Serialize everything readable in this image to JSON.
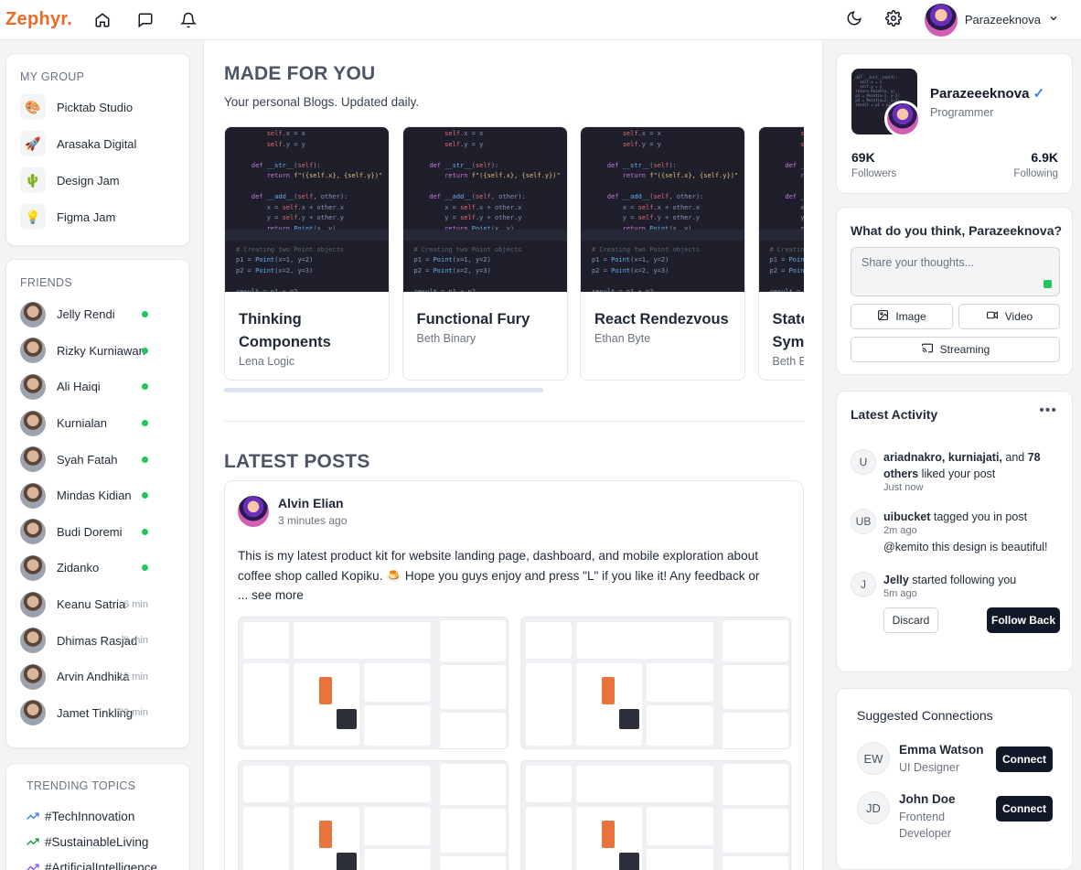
{
  "brand": {
    "name": "Zephyr."
  },
  "topbar": {
    "username": "Parazeeknova"
  },
  "my_group": {
    "title": "MY GROUP",
    "items": [
      {
        "label": "Picktab Studio",
        "icon": "palette-icon",
        "glyph": "🎨"
      },
      {
        "label": "Arasaka Digital",
        "icon": "rocket-icon",
        "glyph": "🚀"
      },
      {
        "label": "Design Jam",
        "icon": "cactus-icon",
        "glyph": "🌵"
      },
      {
        "label": "Figma Jam",
        "icon": "lightbulb-icon",
        "glyph": "💡"
      }
    ]
  },
  "friends": {
    "title": "FRIENDS",
    "items": [
      {
        "name": "Jelly Rendi",
        "status": "online",
        "time": ""
      },
      {
        "name": "Rizky Kurniawan",
        "status": "online",
        "time": ""
      },
      {
        "name": "Ali Haiqi",
        "status": "online",
        "time": ""
      },
      {
        "name": "Kurnialan",
        "status": "online",
        "time": ""
      },
      {
        "name": "Syah Fatah",
        "status": "online",
        "time": ""
      },
      {
        "name": "Mindas Kidian",
        "status": "online",
        "time": ""
      },
      {
        "name": "Budi Doremi",
        "status": "online",
        "time": ""
      },
      {
        "name": "Zidanko",
        "status": "online",
        "time": ""
      },
      {
        "name": "Keanu Satria",
        "status": "away",
        "time": "6 min"
      },
      {
        "name": "Dhimas Rasjad",
        "status": "away",
        "time": "9 min"
      },
      {
        "name": "Arvin Andhika",
        "status": "away",
        "time": "15 min"
      },
      {
        "name": "Jamet Tinkling",
        "status": "away",
        "time": "23 min"
      }
    ]
  },
  "trending": {
    "title": "TRENDING TOPICS",
    "items": [
      "#TechInnovation",
      "#SustainableLiving",
      "#ArtificialIntelligence"
    ]
  },
  "made_for_you": {
    "title": "MADE FOR YOU",
    "subtitle": "Your personal Blogs. Updated daily.",
    "blogs": [
      {
        "title": "Thinking Components",
        "author": "Lena Logic"
      },
      {
        "title": "Functional Fury",
        "author": "Beth Binary"
      },
      {
        "title": "React Rendezvous",
        "author": "Ethan Byte"
      },
      {
        "title": "Stateful Symphony",
        "author": "Beth Binary"
      }
    ]
  },
  "latest_posts": {
    "title": "LATEST POSTS",
    "post": {
      "author": "Alvin Elian",
      "time": "3 minutes ago",
      "text": "This is my latest product kit for website landing page, dashboard, and mobile exploration about coffee shop called Kopiku. 🍮 Hope you guys enjoy and press \"L\" if you like it! Any feedback or ...",
      "see_more": "see more"
    }
  },
  "profile": {
    "name": "Parazeeeknova",
    "verified": "✓",
    "role": "Programmer",
    "followers_value": "69K",
    "followers_label": "Followers",
    "following_value": "6.9K",
    "following_label": "Following"
  },
  "compose": {
    "title": "What do you think, Parazeeknova?",
    "placeholder": "Share your thoughts...",
    "image_label": "Image",
    "video_label": "Video",
    "streaming_label": "Streaming"
  },
  "activity": {
    "title": "Latest Activity",
    "more": "•••",
    "items": [
      {
        "initials": "U",
        "actor": "ariadnakro, kurniajati,",
        "rest": " and ",
        "actor2": "78 others",
        "rest2": " liked your post",
        "time": "Just now",
        "extra": ""
      },
      {
        "initials": "UB",
        "actor": "uibucket",
        "rest": " tagged you in post",
        "actor2": "",
        "rest2": "",
        "time": "2m ago",
        "extra": "@kemito this design is beautiful!"
      },
      {
        "initials": "J",
        "actor": "Jelly",
        "rest": " started following you",
        "actor2": "",
        "rest2": "",
        "time": "5m ago",
        "extra": ""
      }
    ],
    "discard_label": "Discard",
    "follow_back_label": "Follow Back"
  },
  "suggested": {
    "title": "Suggested Connections",
    "items": [
      {
        "initials": "EW",
        "name": "Emma Watson",
        "role": "UI Designer",
        "button": "Connect"
      },
      {
        "initials": "JD",
        "name": "John Doe",
        "role": "Frontend Developer",
        "button": "Connect"
      }
    ]
  },
  "colors": {
    "brand": "#ea6a2a",
    "online": "#22c55e",
    "verified": "#3b82f6",
    "dark_button": "#111827"
  }
}
